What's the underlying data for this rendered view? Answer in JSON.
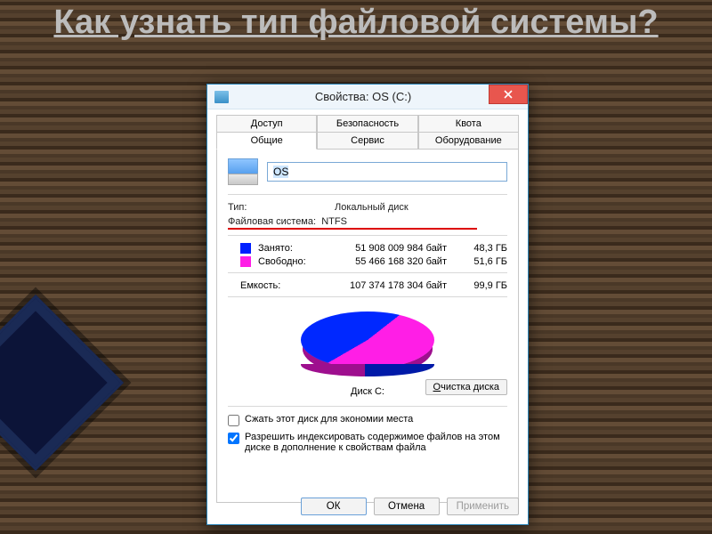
{
  "slide_title": "Как узнать тип файловой системы?",
  "titlebar": {
    "text": "Свойства: OS (C:)"
  },
  "close_button": {
    "symbol": "×"
  },
  "tabs_row1": [
    {
      "label": "Доступ"
    },
    {
      "label": "Безопасность"
    },
    {
      "label": "Квота"
    }
  ],
  "tabs_row2": [
    {
      "label": "Общие"
    },
    {
      "label": "Сервис"
    },
    {
      "label": "Оборудование"
    }
  ],
  "drive": {
    "name": "OS"
  },
  "info": {
    "type_label": "Тип:",
    "type_value": "Локальный диск",
    "fs_label": "Файловая система:",
    "fs_value": "NTFS"
  },
  "usage": {
    "used_label": "Занято:",
    "used_bytes": "51 908 009 984 байт",
    "used_hr": "48,3 ГБ",
    "free_label": "Свободно:",
    "free_bytes": "55 466 168 320 байт",
    "free_hr": "51,6 ГБ",
    "cap_label": "Емкость:",
    "cap_bytes": "107 374 178 304 байт",
    "cap_hr": "99,9 ГБ"
  },
  "disk_caption": "Диск C:",
  "cleanup": {
    "pre": "О",
    "rest": "чистка диска"
  },
  "checks": {
    "compress": "Сжать этот диск для экономии места",
    "index": "Разрешить индексировать содержимое файлов на этом диске в дополнение к свойствам файла"
  },
  "buttons": {
    "ok": "ОК",
    "cancel": "Отмена",
    "apply": "Применить"
  },
  "colors": {
    "used": "#0020ff",
    "free": "#ff1ee6"
  },
  "chart_data": {
    "type": "pie",
    "title": "Диск C:",
    "series": [
      {
        "name": "Занято",
        "value": 48.3,
        "bytes": 51908009984,
        "color": "#0020ff"
      },
      {
        "name": "Свободно",
        "value": 51.6,
        "bytes": 55466168320,
        "color": "#ff1ee6"
      }
    ],
    "total": {
      "label": "Емкость",
      "value": 99.9,
      "bytes": 107374178304,
      "unit": "ГБ"
    }
  }
}
